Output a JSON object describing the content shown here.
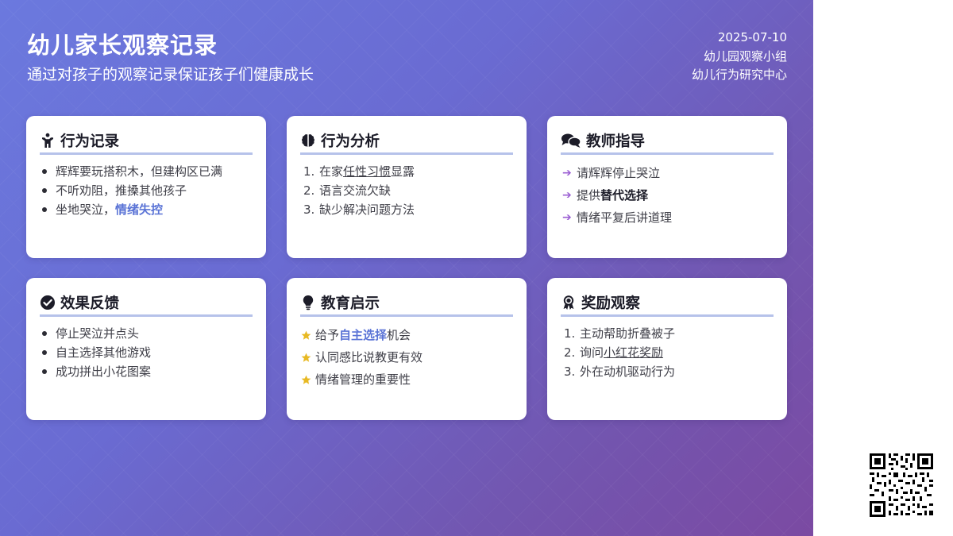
{
  "header": {
    "title": "幼儿家长观察记录",
    "subtitle": "通过对孩子的观察记录保证孩子们健康成长",
    "date": "2025-07-10",
    "org": "幼儿园观察小组",
    "center": "幼儿行为研究中心"
  },
  "colors": {
    "background_start": "#6b79de",
    "background_end": "#7b4aa2",
    "accent_blue": "#5b74d6",
    "arrow_purple": "#9b5fd3",
    "star_gold": "#e8b923",
    "heading_underline": "#b6c2ea"
  },
  "cards": {
    "behavior": {
      "icon": "child-icon",
      "title": "行为记录",
      "items": [
        "辉辉要玩搭积木，但建构区已满",
        "不听劝阻，推搡其他孩子",
        "坐地哭泣，"
      ],
      "item3_highlight": "情绪失控"
    },
    "analysis": {
      "icon": "brain-icon",
      "title": "行为分析",
      "item1_num": "1.",
      "item1_pre": "在家",
      "item1_underline": "任性习惯",
      "item1_post": "显露",
      "item2_num": "2.",
      "item2": "语言交流欠缺",
      "item3_num": "3.",
      "item3": "缺少解决问题方法"
    },
    "teacher": {
      "icon": "comments-icon",
      "title": "教师指导",
      "item1": "请辉辉停止哭泣",
      "item2_pre": "提供",
      "item2_bold": "替代选择",
      "item3": "情绪平复后讲道理"
    },
    "feedback": {
      "icon": "check-circle-icon",
      "title": "效果反馈",
      "items": [
        "停止哭泣并点头",
        "自主选择其他游戏",
        "成功拼出小花图案"
      ]
    },
    "insight": {
      "icon": "lightbulb-icon",
      "title": "教育启示",
      "item1_pre": "给予",
      "item1_highlight": "自主选择",
      "item1_post": "机会",
      "item2": "认同感比说教更有效",
      "item3": "情绪管理的重要性"
    },
    "reward": {
      "icon": "award-icon",
      "title": "奖励观察",
      "item1_num": "1.",
      "item1": "主动帮助折叠被子",
      "item2_num": "2.",
      "item2_pre": "询问",
      "item2_underline": "小红花奖励",
      "item3_num": "3.",
      "item3": "外在动机驱动行为"
    }
  }
}
